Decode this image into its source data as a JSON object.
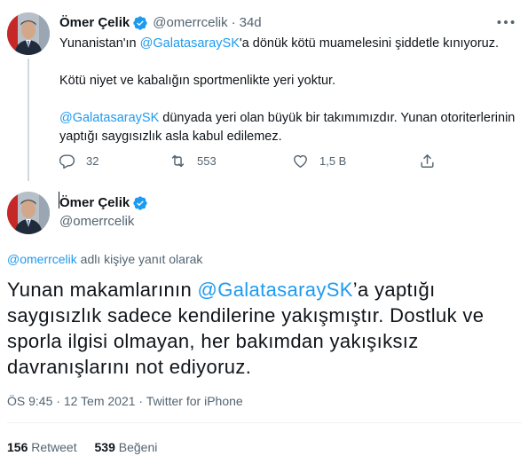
{
  "colors": {
    "accent": "#1d9bf0",
    "text": "#0f1419",
    "secondary": "#536471",
    "verified": "#1d9bf0"
  },
  "tweet1": {
    "author_name": "Ömer Çelik",
    "author_handle": "@omerrcelik",
    "separator": "·",
    "time": "34d",
    "line1_mention": "@GalatasaraySK",
    "line1_prefix": "Yunanistan'ın ",
    "line1_suffix": "'a dönük kötü muamelesini şiddetle kınıyoruz.",
    "line2": "Kötü niyet ve kabalığın sportmenlikte yeri yoktur.",
    "line3_mention": "@GalatasaraySK",
    "line3_suffix": " dünyada yeri olan büyük bir takımımızdır. Yunan otoriterlerinin yaptığı saygısızlık asla kabul edilemez.",
    "reply_count": "32",
    "retweet_count": "553",
    "like_count": "1,5 B",
    "icons": [
      "more-icon",
      "reply-icon",
      "retweet-icon",
      "like-icon",
      "share-icon",
      "verified-icon"
    ]
  },
  "tweet2": {
    "author_name": "Ömer Çelik",
    "author_handle": "@omerrcelik",
    "reply_to_handle": "@omerrcelik",
    "reply_to_suffix": " adlı kişiye yanıt olarak",
    "text_prefix": "Yunan makamlarının ",
    "text_mention": "@GalatasaraySK",
    "text_suffix": "’a yaptığı saygısızlık sadece kendilerine yakışmıştır. Dostluk ve sporla ilgisi olmayan, her bakımdan yakışıksız davranışlarını not ediyoruz.",
    "time": "ÖS 9:45",
    "date": "12 Tem 2021",
    "source": "Twitter for iPhone",
    "meta_sep": "·",
    "retweets_count": "156",
    "retweets_label": "Retweet",
    "likes_count": "539",
    "likes_label": "Beğeni"
  }
}
